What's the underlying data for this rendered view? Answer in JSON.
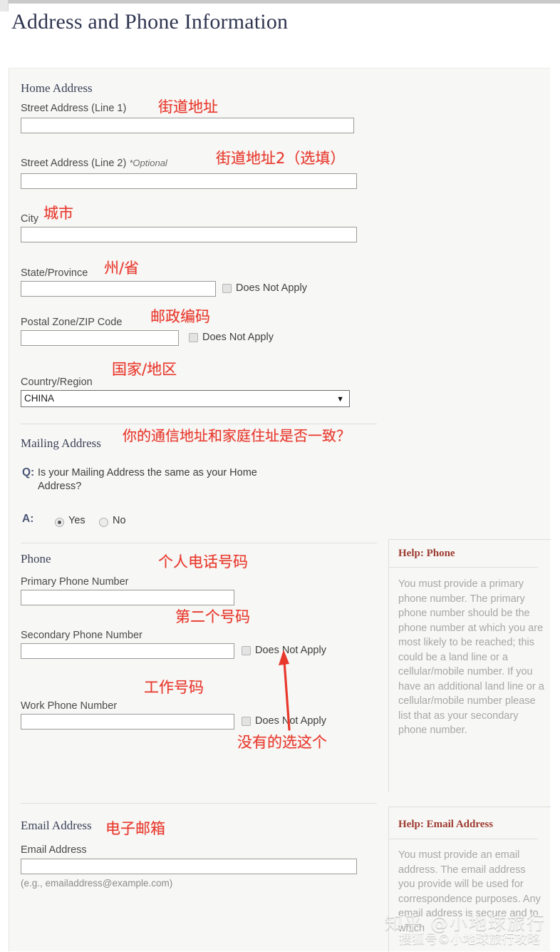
{
  "page_title": "Address and Phone Information",
  "home_address": {
    "heading": "Home Address",
    "street1_label": "Street Address (Line 1)",
    "street1_value": "",
    "street2_label": "Street Address (Line 2)",
    "street2_optional": "*Optional",
    "street2_value": "",
    "city_label": "City",
    "city_value": "",
    "state_label": "State/Province",
    "state_value": "",
    "state_dna_label": "Does Not Apply",
    "postal_label": "Postal Zone/ZIP Code",
    "postal_value": "",
    "postal_dna_label": "Does Not Apply",
    "country_label": "Country/Region",
    "country_value": "CHINA",
    "country_caret": "▼"
  },
  "mailing_address": {
    "heading": "Mailing Address",
    "q_marker": "Q:",
    "question": "Is your Mailing Address the same as your Home Address?",
    "a_marker": "A:",
    "yes_label": "Yes",
    "no_label": "No",
    "selected": "Yes"
  },
  "phone": {
    "heading": "Phone",
    "primary_label": "Primary Phone Number",
    "primary_value": "",
    "secondary_label": "Secondary Phone Number",
    "secondary_value": "",
    "secondary_dna_label": "Does Not Apply",
    "work_label": "Work Phone Number",
    "work_value": "",
    "work_dna_label": "Does Not Apply"
  },
  "email": {
    "heading": "Email Address",
    "label": "Email Address",
    "value": "",
    "hint": "(e.g., emailaddress@example.com)"
  },
  "help_phone": {
    "title": "Help: Phone",
    "body": "You must provide a primary phone number. The primary phone number should be the phone number at which you are most likely to be reached; this could be a land line or a cellular/mobile number. If you have an additional land line or a cellular/mobile number please list that as your secondary phone number."
  },
  "help_email": {
    "title": "Help: Email Address",
    "body": "You must provide an email address.  The email address you provide will be used for correspondence purposes. Any email address is secure and to which"
  },
  "annotations": {
    "street1": "街道地址",
    "street2": "街道地址2（选填）",
    "city": "城市",
    "state": "州/省",
    "postal": "邮政编码",
    "country": "国家/地区",
    "mailing": "你的通信地址和家庭住址是否一致？",
    "primary_phone": "个人电话号码",
    "secondary_phone": "第二个号码",
    "work_phone": "工作号码",
    "pick_this": "没有的选这个",
    "email": "电子邮箱"
  },
  "watermarks": {
    "zhihu": "知乎 @小地球旅行",
    "sohu": "搜狐号©小地球旅行攻略"
  },
  "colors": {
    "annotation_red": "#e8382c",
    "title_blue": "#2f3550",
    "help_red": "#9d3b30",
    "panel_bg": "#f7f7f5"
  }
}
